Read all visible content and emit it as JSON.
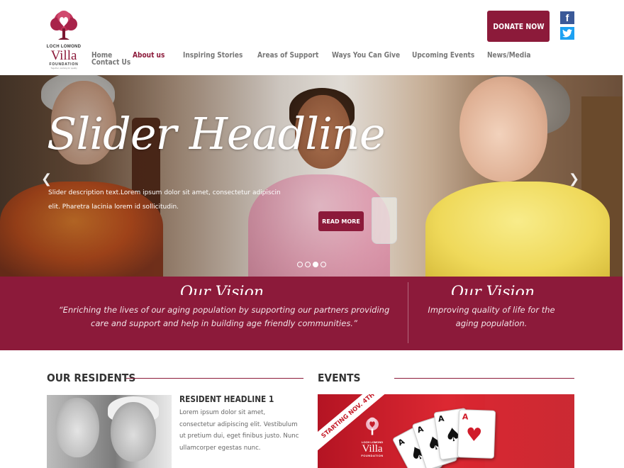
{
  "brand": {
    "logo_top": "LOCH LOMOND",
    "logo_name": "Villa",
    "logo_sub": "FOUNDATION",
    "logo_tagline": "Together, working for quality",
    "accent_color": "#8c1a3a"
  },
  "nav": {
    "items": [
      {
        "label": "Home",
        "active": false
      },
      {
        "label": "Contact Us",
        "active": false
      },
      {
        "label": "About us",
        "active": true
      },
      {
        "label": "Inspiring Stories",
        "active": false
      },
      {
        "label": "Areas of Support",
        "active": false
      },
      {
        "label": "Ways You Can Give",
        "active": false
      },
      {
        "label": "Upcoming Events",
        "active": false
      },
      {
        "label": "News/Media",
        "active": false
      }
    ]
  },
  "header": {
    "donate_label": "DONATE NOW",
    "social": [
      {
        "name": "facebook-icon",
        "glyph": "f",
        "color": "#3b5998"
      },
      {
        "name": "twitter-icon",
        "glyph": "bird",
        "color": "#1da1f2"
      }
    ]
  },
  "slider": {
    "headline": "Slider Headline",
    "description": "Slider description text.Lorem ipsum dolor sit amet, consectetur adipiscin elit. Pharetra lacinia lorem id sollicitudin.",
    "button_label": "READ MORE",
    "prev_icon": "chevron-left-icon",
    "next_icon": "chevron-right-icon",
    "slide_count": 4,
    "active_slide": 3
  },
  "vision": {
    "left_title": "Our Vision",
    "left_text": "“Enriching the lives of our aging population by supporting our partners providing care and support and help in building age friendly communities.”",
    "right_title": "Our Vision",
    "right_text": "Improving quality of life for the aging population."
  },
  "residents": {
    "title": "OUR RESIDENTS",
    "headline": "RESIDENT HEADLINE 1",
    "text": "Lorem ipsum dolor sit amet, consectetur adipiscing elit. Vestibulum ut pretium dui, eget finibus justo. Nunc ullamcorper egestas nunc."
  },
  "events": {
    "title": "EVENTS",
    "ribbon": "STARTING NOV. 4TH",
    "logo_top": "LOCH LOMOND",
    "logo_name": "Villa",
    "logo_sub": "FOUNDATION",
    "cards": [
      {
        "rank": "A",
        "suit": "♠",
        "color": "black"
      },
      {
        "rank": "A",
        "suit": "♠",
        "color": "black"
      },
      {
        "rank": "A",
        "suit": "♠",
        "color": "black"
      },
      {
        "rank": "A",
        "suit": "♥",
        "color": "red"
      }
    ]
  }
}
